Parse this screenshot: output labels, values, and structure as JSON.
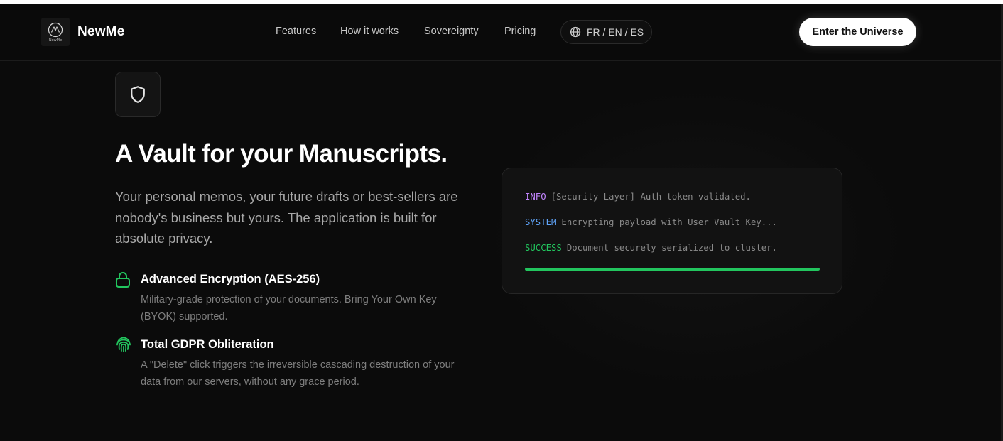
{
  "header": {
    "logo_text": "NewMe",
    "brand": "NewMe",
    "nav": [
      "Features",
      "How it works",
      "Sovereignty",
      "Pricing"
    ],
    "lang_label": "FR / EN / ES",
    "cta_label": "Enter the Universe"
  },
  "hero": {
    "title": "A Vault for your Manuscripts.",
    "lead": "Your personal memos, your future drafts or best-sellers are nobody's business but yours. The application is built for absolute privacy."
  },
  "features": [
    {
      "title": "Advanced Encryption (AES-256)",
      "desc": "Military-grade protection of your documents. Bring Your Own Key (BYOK) supported.",
      "icon": "lock-icon"
    },
    {
      "title": "Total GDPR Obliteration",
      "desc": "A \"Delete\" click triggers the irreversible cascading destruction of your data from our servers, without any grace period.",
      "icon": "fingerprint-icon"
    }
  ],
  "terminal": {
    "lines": [
      {
        "tag": "INFO",
        "text": "[Security Layer] Auth token validated.",
        "color": "#c084fc"
      },
      {
        "tag": "SYSTEM",
        "text": "Encrypting payload with User Vault Key...",
        "color": "#60a5fa"
      },
      {
        "tag": "SUCCESS",
        "text": "Document securely serialized to cluster.",
        "color": "#22c55e"
      }
    ],
    "progress": 1.0
  },
  "colors": {
    "accent_green": "#22c55e",
    "background": "#0b0b0b"
  }
}
